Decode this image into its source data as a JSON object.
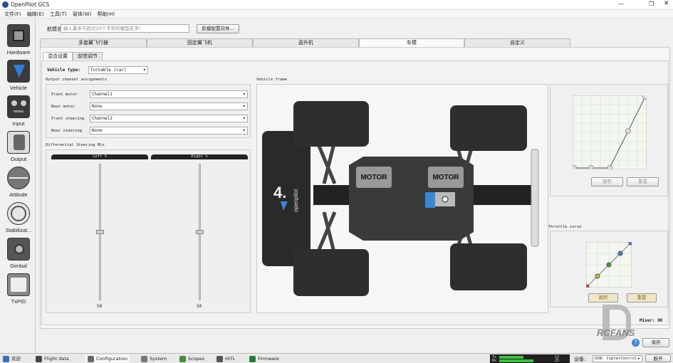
{
  "window": {
    "title": "OpenPilot GCS"
  },
  "menu": [
    "文件(F)",
    "编辑(E)",
    "工具(T)",
    "窗体(W)",
    "帮助(H)"
  ],
  "sidebar": [
    {
      "label": "Hardware",
      "icon": "chip-icon"
    },
    {
      "label": "Vehicle",
      "icon": "vehicle-icon"
    },
    {
      "label": "Input",
      "icon": "gamepad-icon"
    },
    {
      "label": "Output",
      "icon": "motor-icon"
    },
    {
      "label": "Attitude",
      "icon": "horizon-icon"
    },
    {
      "label": "Stabilizat...",
      "icon": "gyro-icon"
    },
    {
      "label": "Gimbal",
      "icon": "camera-icon"
    },
    {
      "label": "TxPID",
      "icon": "scope-icon"
    }
  ],
  "airframe": {
    "name_label": "航模名字",
    "name_placeholder": "输入最多不超过20个字符的模型名字r",
    "wizard_button": "航模配置向导..."
  },
  "vehicle_tabs": [
    "多旋翼飞行器",
    "固定翼飞机",
    "直升机",
    "车模",
    "自定义"
  ],
  "sub_tabs": [
    "混合设置",
    "前馈调节"
  ],
  "vehicle_type": {
    "label": "Vehicle type:",
    "value": "Turnable (car)"
  },
  "output_section": {
    "title": "Output channel assignments",
    "rows": [
      {
        "label": "Front motor",
        "value": "Channel1"
      },
      {
        "label": "Rear motor",
        "value": "None"
      },
      {
        "label": "Front steering",
        "value": "Channel2"
      },
      {
        "label": "Rear steering",
        "value": "None"
      }
    ]
  },
  "diff_mix": {
    "title": "Differential Steering Mix",
    "left_label": "Left %",
    "right_label": "Right %",
    "left_value": "50",
    "right_value": "50",
    "left_level": 0.5,
    "right_level": 0.5
  },
  "frame": {
    "title": "Vehicle frame",
    "motor_front": "MOTOR",
    "motor_rear": "MOTOR",
    "logo": "openpilot"
  },
  "curve1": {
    "default_button": "面积",
    "reset_button": "重置"
  },
  "throttle": {
    "title": "Throttle curve",
    "default_button": "面积",
    "reset_button": "重置"
  },
  "mixer_status": "Mixer: OK",
  "save_button": "保存",
  "watermark": "RCFANS",
  "statusbar": {
    "tabs": [
      {
        "label": "欢迎",
        "icon": "home-icon",
        "color": "#3a6fb0"
      },
      {
        "label": "Flight data",
        "icon": "flight-icon",
        "color": "#444"
      },
      {
        "label": "Configuration",
        "icon": "wrench-icon",
        "color": "#666"
      },
      {
        "label": "System",
        "icon": "system-icon",
        "color": "#777"
      },
      {
        "label": "Scopes",
        "icon": "scope-icon",
        "color": "#4a8a3a"
      },
      {
        "label": "HITL",
        "icon": "hitl-icon",
        "color": "#555"
      },
      {
        "label": "Firmware",
        "icon": "firmware-icon",
        "color": "#2a7a3a"
      }
    ],
    "tx_label": "Tx",
    "rx_label": "Rx",
    "tx_value": "12",
    "rx_value": "25",
    "device_label": "设备:",
    "device_value": "USB: CopterControl",
    "disconnect": "断开"
  }
}
